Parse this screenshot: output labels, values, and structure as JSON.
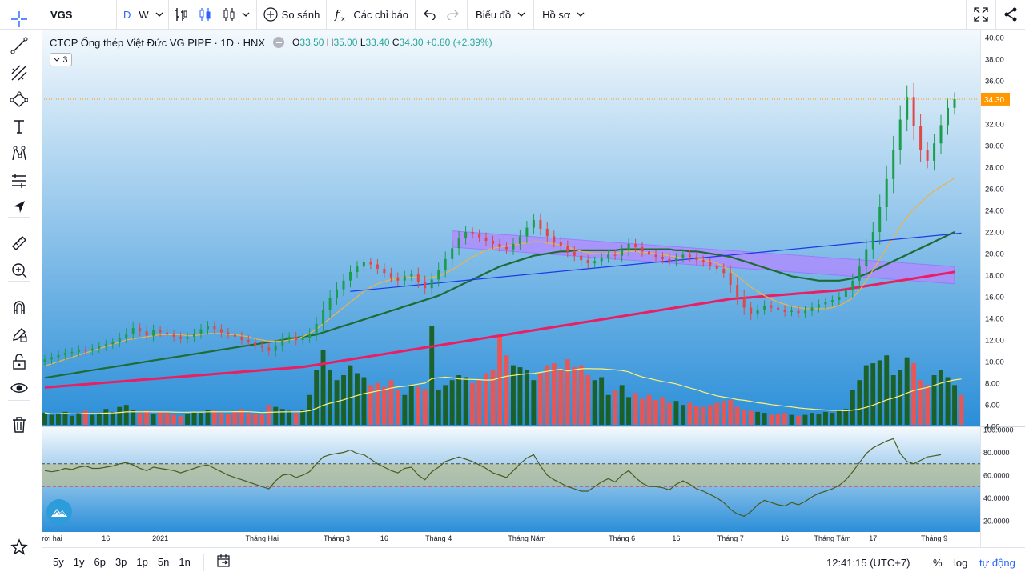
{
  "toolbar": {
    "symbol": "VGS",
    "interval_d": "D",
    "interval_w": "W",
    "compare_label": "So sánh",
    "indicators_label": "Các chỉ báo",
    "chart_label": "Biểu đồ",
    "profile_label": "Hồ sơ",
    "chevron": "˅"
  },
  "legend": {
    "title": "CTCP Ống thép Việt Đức VG PIPE · 1D · HNX",
    "o_label": "O",
    "o_value": "33.50",
    "h_label": "H",
    "h_value": "35.00",
    "l_label": "L",
    "l_value": "33.40",
    "c_label": "C",
    "c_value": "34.30",
    "change": "+0.80 (+2.39%)",
    "collapse_count": "3"
  },
  "colors": {
    "up": "#1b5e20",
    "down": "#ef5350",
    "ma_short": "#e6b450",
    "ma_mid": "#1e6b34",
    "ma_long": "#e91e63",
    "trend": "#1e3ae6",
    "channel": "#b388ff",
    "rsi_line": "#4b5a1e",
    "accent": "#2962ff",
    "price_tag": "#ff9800"
  },
  "bottom": {
    "ranges": [
      "5y",
      "1y",
      "6p",
      "3p",
      "1p",
      "5n",
      "1n"
    ],
    "clock": "12:41:15 (UTC+7)",
    "percent": "%",
    "log": "log",
    "auto": "tự động"
  },
  "chart_data": {
    "type": "candlestick",
    "symbol": "VGS",
    "title": "CTCP Ống thép Việt Đức VG PIPE · 1D · HNX",
    "last_price": 34.3,
    "last_price_label": "34.30",
    "price_axis": {
      "min": 4.0,
      "max": 40.0,
      "ticks": [
        "40.00",
        "38.00",
        "36.00",
        "34.00",
        "32.00",
        "30.00",
        "28.00",
        "26.00",
        "24.00",
        "22.00",
        "20.00",
        "18.00",
        "16.00",
        "14.00",
        "12.00",
        "10.00",
        "8.00",
        "6.00",
        "4.00"
      ]
    },
    "rsi_axis": {
      "min": 20,
      "max": 100,
      "ticks": [
        "100.0000",
        "80.0000",
        "60.0000",
        "40.0000",
        "20.0000"
      ],
      "upper_band": 70,
      "lower_band": 50
    },
    "time_labels": [
      {
        "text": "g Mười hai",
        "i": 0
      },
      {
        "text": "16",
        "i": 9
      },
      {
        "text": "2021",
        "i": 17
      },
      {
        "text": "Tháng Hai",
        "i": 32
      },
      {
        "text": "Tháng 3",
        "i": 43
      },
      {
        "text": "16",
        "i": 50
      },
      {
        "text": "Tháng 4",
        "i": 58
      },
      {
        "text": "Tháng Năm",
        "i": 71
      },
      {
        "text": "Tháng 6",
        "i": 85
      },
      {
        "text": "16",
        "i": 93
      },
      {
        "text": "Tháng 7",
        "i": 101
      },
      {
        "text": "16",
        "i": 109
      },
      {
        "text": "Tháng Tám",
        "i": 116
      },
      {
        "text": "17",
        "i": 122
      },
      {
        "text": "Tháng 9",
        "i": 131
      }
    ],
    "close": [
      10.2,
      10.4,
      10.6,
      10.8,
      10.9,
      11.1,
      11.0,
      11.2,
      11.4,
      11.6,
      11.8,
      12.2,
      12.6,
      13.1,
      12.8,
      12.4,
      12.9,
      12.7,
      12.5,
      12.3,
      12.1,
      12.3,
      12.6,
      13.0,
      13.3,
      13.0,
      12.7,
      12.5,
      12.3,
      12.0,
      11.8,
      11.5,
      11.3,
      11.0,
      11.5,
      12.1,
      12.3,
      12.0,
      12.2,
      12.6,
      13.5,
      14.8,
      15.9,
      16.7,
      17.5,
      18.3,
      18.8,
      19.2,
      19.0,
      18.6,
      18.2,
      17.8,
      17.5,
      17.9,
      18.1,
      17.4,
      16.8,
      17.6,
      18.5,
      19.5,
      20.5,
      21.4,
      22.0,
      21.8,
      21.5,
      21.2,
      20.9,
      20.6,
      20.4,
      20.9,
      21.6,
      22.4,
      23.1,
      22.3,
      21.6,
      21.1,
      20.7,
      20.2,
      19.8,
      19.4,
      19.1,
      19.3,
      19.6,
      19.9,
      19.8,
      20.3,
      20.9,
      20.6,
      20.2,
      19.9,
      19.7,
      19.5,
      19.3,
      19.6,
      19.9,
      19.7,
      19.4,
      19.2,
      18.9,
      18.6,
      18.2,
      17.1,
      16.0,
      15.0,
      14.4,
      14.8,
      15.2,
      15.0,
      14.8,
      14.6,
      14.7,
      14.5,
      14.7,
      15.0,
      15.3,
      15.5,
      15.7,
      16.0,
      16.6,
      17.5,
      18.8,
      20.4,
      22.0,
      24.3,
      26.9,
      29.6,
      32.4,
      34.5,
      31.8,
      29.6,
      28.6,
      30.2,
      31.9,
      33.5,
      34.3
    ],
    "volume_axis_note": "volume bars (relative, max = 1.0)",
    "volume": [
      0.12,
      0.1,
      0.11,
      0.13,
      0.09,
      0.12,
      0.14,
      0.1,
      0.11,
      0.16,
      0.13,
      0.18,
      0.2,
      0.15,
      0.12,
      0.14,
      0.11,
      0.13,
      0.12,
      0.1,
      0.09,
      0.11,
      0.13,
      0.12,
      0.15,
      0.14,
      0.12,
      0.11,
      0.13,
      0.16,
      0.12,
      0.11,
      0.1,
      0.2,
      0.18,
      0.16,
      0.14,
      0.12,
      0.15,
      0.3,
      0.55,
      0.75,
      0.55,
      0.45,
      0.5,
      0.6,
      0.52,
      0.48,
      0.4,
      0.42,
      0.38,
      0.45,
      0.35,
      0.3,
      0.4,
      0.38,
      0.36,
      1.0,
      0.35,
      0.4,
      0.45,
      0.5,
      0.48,
      0.42,
      0.46,
      0.52,
      0.55,
      0.9,
      0.7,
      0.6,
      0.58,
      0.55,
      0.45,
      0.52,
      0.6,
      0.62,
      0.55,
      0.66,
      0.58,
      0.6,
      0.5,
      0.45,
      0.48,
      0.3,
      0.35,
      0.4,
      0.28,
      0.32,
      0.26,
      0.3,
      0.25,
      0.28,
      0.22,
      0.24,
      0.2,
      0.22,
      0.19,
      0.18,
      0.2,
      0.22,
      0.24,
      0.25,
      0.18,
      0.15,
      0.14,
      0.13,
      0.12,
      0.1,
      0.11,
      0.12,
      0.1,
      0.09,
      0.1,
      0.12,
      0.11,
      0.13,
      0.12,
      0.14,
      0.16,
      0.35,
      0.45,
      0.6,
      0.62,
      0.65,
      0.7,
      0.5,
      0.55,
      0.68,
      0.62,
      0.45,
      0.4,
      0.5,
      0.55,
      0.48,
      0.4,
      0.3
    ],
    "ma_short": [
      9.6,
      9.8,
      10.0,
      10.2,
      10.4,
      10.6,
      10.8,
      11.0,
      11.2,
      11.4,
      11.6,
      11.8,
      12.0,
      12.1,
      12.2,
      12.3,
      12.4,
      12.5,
      12.5,
      12.5,
      12.5,
      12.4,
      12.4,
      12.5,
      12.6,
      12.6,
      12.6,
      12.5,
      12.5,
      12.4,
      12.3,
      12.1,
      12.0,
      11.9,
      11.9,
      11.9,
      12.0,
      12.1,
      12.3,
      12.6,
      13.0,
      13.5,
      14.0,
      14.5,
      15.0,
      15.5,
      16.0,
      16.5,
      16.9,
      17.2,
      17.4,
      17.6,
      17.7,
      17.8,
      17.8,
      17.8,
      17.7,
      17.8,
      17.9,
      18.2,
      18.5,
      18.9,
      19.3,
      19.7,
      20.0,
      20.3,
      20.5,
      20.6,
      20.7,
      20.8,
      20.9,
      21.0,
      21.1,
      21.1,
      21.0,
      20.9,
      20.8,
      20.6,
      20.4,
      20.2,
      20.1,
      20.0,
      20.0,
      20.0,
      20.0,
      20.1,
      20.2,
      20.2,
      20.1,
      20.1,
      20.0,
      19.9,
      19.8,
      19.7,
      19.6,
      19.6,
      19.5,
      19.4,
      19.3,
      19.1,
      18.8,
      18.4,
      17.9,
      17.4,
      16.9,
      16.5,
      16.1,
      15.8,
      15.5,
      15.3,
      15.1,
      15.0,
      14.9,
      14.9,
      14.9,
      14.9,
      15.0,
      15.2,
      15.5,
      15.9,
      16.6,
      17.5,
      18.5,
      19.5,
      20.5,
      21.5,
      22.5,
      23.4,
      24.1,
      24.7,
      25.3,
      25.8,
      26.2,
      26.6,
      27.0
    ],
    "ma_mid": [
      8.5,
      8.6,
      8.7,
      8.8,
      8.9,
      9.0,
      9.1,
      9.2,
      9.3,
      9.4,
      9.5,
      9.6,
      9.7,
      9.8,
      9.9,
      10.0,
      10.1,
      10.2,
      10.3,
      10.4,
      10.5,
      10.6,
      10.7,
      10.8,
      10.9,
      11.0,
      11.1,
      11.2,
      11.3,
      11.4,
      11.5,
      11.6,
      11.7,
      11.8,
      11.9,
      12.0,
      12.1,
      12.2,
      12.3,
      12.4,
      12.5,
      12.7,
      12.9,
      13.1,
      13.3,
      13.5,
      13.7,
      13.9,
      14.1,
      14.3,
      14.5,
      14.7,
      14.9,
      15.1,
      15.3,
      15.5,
      15.7,
      15.9,
      16.1,
      16.4,
      16.7,
      17.0,
      17.3,
      17.6,
      17.9,
      18.2,
      18.5,
      18.8,
      19.0,
      19.2,
      19.4,
      19.6,
      19.8,
      19.9,
      20.0,
      20.1,
      20.2,
      20.2,
      20.3,
      20.3,
      20.3,
      20.3,
      20.3,
      20.3,
      20.3,
      20.4,
      20.4,
      20.4,
      20.4,
      20.4,
      20.4,
      20.4,
      20.4,
      20.3,
      20.3,
      20.2,
      20.2,
      20.1,
      20.0,
      19.9,
      19.8,
      19.7,
      19.5,
      19.3,
      19.1,
      18.9,
      18.7,
      18.5,
      18.3,
      18.1,
      17.9,
      17.8,
      17.7,
      17.6,
      17.5,
      17.5,
      17.5,
      17.5,
      17.6,
      17.7,
      17.9,
      18.1,
      18.4,
      18.7,
      19.0,
      19.3,
      19.6,
      19.9,
      20.2,
      20.5,
      20.8,
      21.1,
      21.4,
      21.7,
      22.0
    ],
    "ma_long": [
      7.6,
      7.65,
      7.7,
      7.75,
      7.8,
      7.85,
      7.9,
      7.95,
      8.0,
      8.05,
      8.1,
      8.15,
      8.2,
      8.25,
      8.3,
      8.35,
      8.4,
      8.45,
      8.5,
      8.55,
      8.6,
      8.65,
      8.7,
      8.75,
      8.8,
      8.85,
      8.9,
      8.95,
      9.0,
      9.05,
      9.1,
      9.15,
      9.2,
      9.25,
      9.3,
      9.35,
      9.4,
      9.45,
      9.5,
      9.6,
      9.7,
      9.8,
      9.9,
      10.0,
      10.1,
      10.2,
      10.3,
      10.4,
      10.5,
      10.6,
      10.7,
      10.8,
      10.9,
      11.0,
      11.1,
      11.2,
      11.3,
      11.4,
      11.5,
      11.6,
      11.7,
      11.8,
      11.9,
      12.0,
      12.1,
      12.2,
      12.3,
      12.4,
      12.5,
      12.6,
      12.7,
      12.8,
      12.9,
      13.0,
      13.1,
      13.2,
      13.3,
      13.4,
      13.5,
      13.6,
      13.7,
      13.8,
      13.9,
      14.0,
      14.1,
      14.2,
      14.3,
      14.4,
      14.5,
      14.6,
      14.7,
      14.8,
      14.9,
      15.0,
      15.1,
      15.2,
      15.3,
      15.4,
      15.5,
      15.6,
      15.7,
      15.8,
      15.85,
      15.9,
      15.95,
      16.0,
      16.05,
      16.1,
      16.15,
      16.2,
      16.25,
      16.3,
      16.35,
      16.4,
      16.45,
      16.5,
      16.55,
      16.6,
      16.7,
      16.8,
      16.9,
      17.0,
      17.1,
      17.2,
      17.3,
      17.4,
      17.5,
      17.6,
      17.7,
      17.8,
      17.9,
      18.0,
      18.1,
      18.2,
      18.3
    ],
    "rsi": [
      64,
      63,
      64,
      66,
      65,
      67,
      68,
      66,
      66,
      67,
      68,
      70,
      71,
      69,
      66,
      64,
      67,
      66,
      65,
      64,
      62,
      64,
      66,
      68,
      69,
      66,
      63,
      60,
      58,
      56,
      54,
      52,
      50,
      48,
      55,
      60,
      61,
      58,
      60,
      63,
      70,
      76,
      78,
      79,
      80,
      82,
      79,
      78,
      74,
      70,
      67,
      64,
      62,
      66,
      67,
      60,
      56,
      63,
      67,
      72,
      74,
      76,
      74,
      72,
      69,
      66,
      62,
      60,
      58,
      64,
      70,
      75,
      78,
      68,
      60,
      56,
      53,
      50,
      48,
      46,
      46,
      50,
      54,
      57,
      54,
      60,
      64,
      58,
      53,
      50,
      50,
      49,
      47,
      52,
      55,
      52,
      48,
      46,
      43,
      40,
      36,
      30,
      26,
      24,
      28,
      34,
      38,
      36,
      34,
      33,
      36,
      34,
      37,
      41,
      44,
      46,
      48,
      51,
      56,
      63,
      71,
      79,
      84,
      87,
      90,
      92,
      79,
      72,
      70,
      73,
      76,
      77,
      78
    ],
    "trendline": {
      "from": {
        "i": 45,
        "price": 16.5
      },
      "to": {
        "i": 135,
        "price": 21.9
      }
    },
    "channel": {
      "upper": {
        "from": {
          "i": 60,
          "price": 22.1
        },
        "to": {
          "i": 134,
          "price": 18.8
        }
      },
      "lower": {
        "from": {
          "i": 60,
          "price": 20.6
        },
        "to": {
          "i": 134,
          "price": 17.2
        }
      }
    }
  }
}
